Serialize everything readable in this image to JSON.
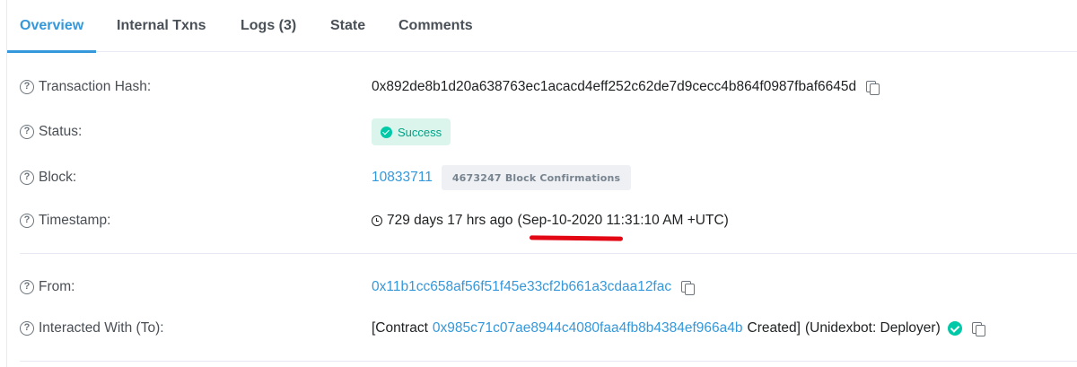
{
  "tabs": [
    {
      "label": "Overview",
      "active": true
    },
    {
      "label": "Internal Txns",
      "active": false
    },
    {
      "label": "Logs (3)",
      "active": false
    },
    {
      "label": "State",
      "active": false
    },
    {
      "label": "Comments",
      "active": false
    }
  ],
  "help_glyph": "?",
  "rows": {
    "tx_hash": {
      "label": "Transaction Hash:",
      "value": "0x892de8b1d20a638763ec1acacd4eff252c62de7d9cecc4b864f0987fbaf6645d"
    },
    "status": {
      "label": "Status:",
      "value": "Success"
    },
    "block": {
      "label": "Block:",
      "number": "10833711",
      "confirmations": "4673247 Block Confirmations"
    },
    "timestamp": {
      "label": "Timestamp:",
      "ago": "729 days 17 hrs ago",
      "datetime": "(Sep-10-2020 11:31:10 AM +UTC)"
    },
    "from": {
      "label": "From:",
      "address": "0x11b1cc658af56f51f45e33cf2b661a3cdaa12fac"
    },
    "to": {
      "label": "Interacted With (To):",
      "prefix": "[Contract",
      "contract": "0x985c71c07ae8944c4080faa4fb8b4384ef966a4b",
      "suffix": "Created]",
      "name": "(Unidexbot: Deployer)"
    }
  },
  "colors": {
    "accent": "#3498db",
    "success": "#00c9a7",
    "annotation": "#e30613"
  }
}
